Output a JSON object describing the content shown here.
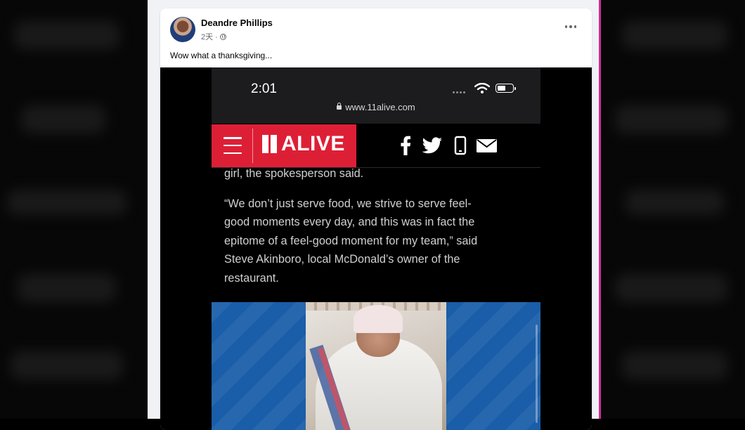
{
  "post": {
    "author": "Deandre Phillips",
    "time": "2天 ·",
    "text": "Wow what a thanksgiving..."
  },
  "phone": {
    "time": "2:01",
    "url": "www.11alive.com",
    "brand": "ALIVE",
    "social_icons": [
      "facebook-icon",
      "twitter-icon",
      "mobile-icon",
      "email-icon"
    ]
  },
  "article": {
    "partial_line": "girl, the spokesperson said.",
    "quote_lines": [
      "“We don’t just serve food, we strive to serve feel-",
      "good moments every day, and this was in fact the",
      "epitome of a feel-good moment for my team,” said",
      "Steve Akinboro, local McDonald’s owner of the",
      "restaurant."
    ]
  },
  "colors": {
    "brand_red": "#dd1f36",
    "photo_bg_blue": "#1a5da8",
    "border_pink": "#d12a9b"
  }
}
